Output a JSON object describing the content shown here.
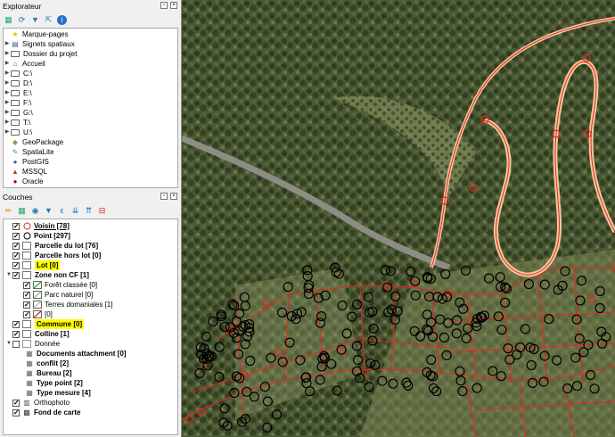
{
  "browser": {
    "title": "Explorateur",
    "items": [
      {
        "label": "Marque-pages",
        "icon": "star-icon",
        "arrow": false
      },
      {
        "label": "Signets spatiaux",
        "icon": "bookmark-icon",
        "arrow": true
      },
      {
        "label": "Dossier du projet",
        "icon": "folder-icon",
        "arrow": true
      },
      {
        "label": "Accueil",
        "icon": "home-icon",
        "arrow": true
      },
      {
        "label": "C:\\",
        "icon": "folder-icon",
        "arrow": true
      },
      {
        "label": "D:\\",
        "icon": "folder-icon",
        "arrow": true
      },
      {
        "label": "E:\\",
        "icon": "folder-icon",
        "arrow": true
      },
      {
        "label": "F:\\",
        "icon": "folder-icon",
        "arrow": true
      },
      {
        "label": "G:\\",
        "icon": "folder-icon",
        "arrow": true
      },
      {
        "label": "T:\\",
        "icon": "folder-icon",
        "arrow": true
      },
      {
        "label": "U:\\",
        "icon": "folder-icon",
        "arrow": true
      },
      {
        "label": "GeoPackage",
        "icon": "geopackage-icon",
        "arrow": false
      },
      {
        "label": "SpatiaLite",
        "icon": "spatialite-icon",
        "arrow": false
      },
      {
        "label": "PostGIS",
        "icon": "postgis-icon",
        "arrow": false
      },
      {
        "label": "MSSQL",
        "icon": "mssql-icon",
        "arrow": false
      },
      {
        "label": "Oracle",
        "icon": "oracle-icon",
        "arrow": false
      }
    ]
  },
  "layers": {
    "title": "Couches",
    "items": [
      {
        "label": "Voisin [78]",
        "checked": true,
        "bold": true,
        "underline": true
      },
      {
        "label": "Point [297]",
        "checked": true,
        "bold": true
      },
      {
        "label": "Parcelle du lot [76]",
        "checked": true,
        "bold": true
      },
      {
        "label": "Parcelle hors lot [0]",
        "checked": true,
        "bold": true
      },
      {
        "label": "Lot [0]",
        "checked": true,
        "bold": true,
        "highlight": true
      },
      {
        "label": "Zone non CF [1]",
        "checked": true,
        "bold": true
      },
      {
        "label": "Forêt classée [0]",
        "checked": true,
        "bold": false
      },
      {
        "label": "Parc naturel [0]",
        "checked": true,
        "bold": false
      },
      {
        "label": "Terres domaniales [1]",
        "checked": true,
        "bold": false
      },
      {
        "label": "[0]",
        "checked": true,
        "bold": false
      },
      {
        "label": "Commune [0]",
        "checked": true,
        "bold": true,
        "highlight": true
      },
      {
        "label": "Colline [1]",
        "checked": true,
        "bold": true
      },
      {
        "label": "Donnée",
        "checked": false,
        "bold": false
      },
      {
        "label": "Documents attachment [0]",
        "checked": false,
        "bold": true
      },
      {
        "label": "conflit [2]",
        "checked": false,
        "bold": true
      },
      {
        "label": "Bureau [2]",
        "checked": false,
        "bold": true
      },
      {
        "label": "Type point [2]",
        "checked": false,
        "bold": true
      },
      {
        "label": "Type mesure [4]",
        "checked": false,
        "bold": true
      },
      {
        "label": "Orthophoto",
        "checked": true,
        "bold": false
      },
      {
        "label": "Fond de carte",
        "checked": true,
        "bold": true
      }
    ]
  },
  "colors": {
    "highlight": "#ffff00",
    "parcel_line": "#e8261e",
    "point_circle": "#000000",
    "road": "#f2c9a0"
  }
}
